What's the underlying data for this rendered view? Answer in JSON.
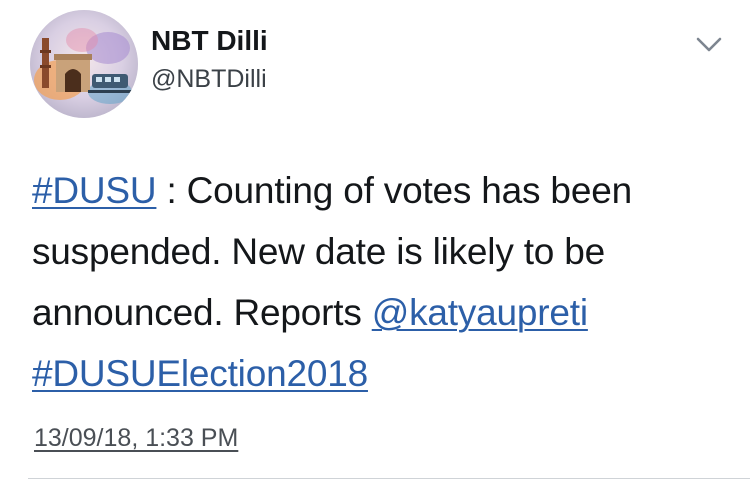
{
  "author": {
    "name": "NBT Dilli",
    "handle": "@NBTDilli",
    "avatar_icon": "india-gate-metro-avatar"
  },
  "menu": {
    "icon": "chevron-down-icon"
  },
  "tweet": {
    "hashtag_1": "#DUSU",
    "text_1": " : Counting of votes has been",
    "text_2": "suspended. New date is likely to be",
    "text_3": "announced. Reports ",
    "mention": "@katyaupreti",
    "hashtag_2": "#DUSUElection2018",
    "timestamp": "13/09/18, 1:33 PM"
  },
  "colors": {
    "link": "#2c5fa8",
    "text": "#14171a",
    "secondary": "#3b4147"
  }
}
